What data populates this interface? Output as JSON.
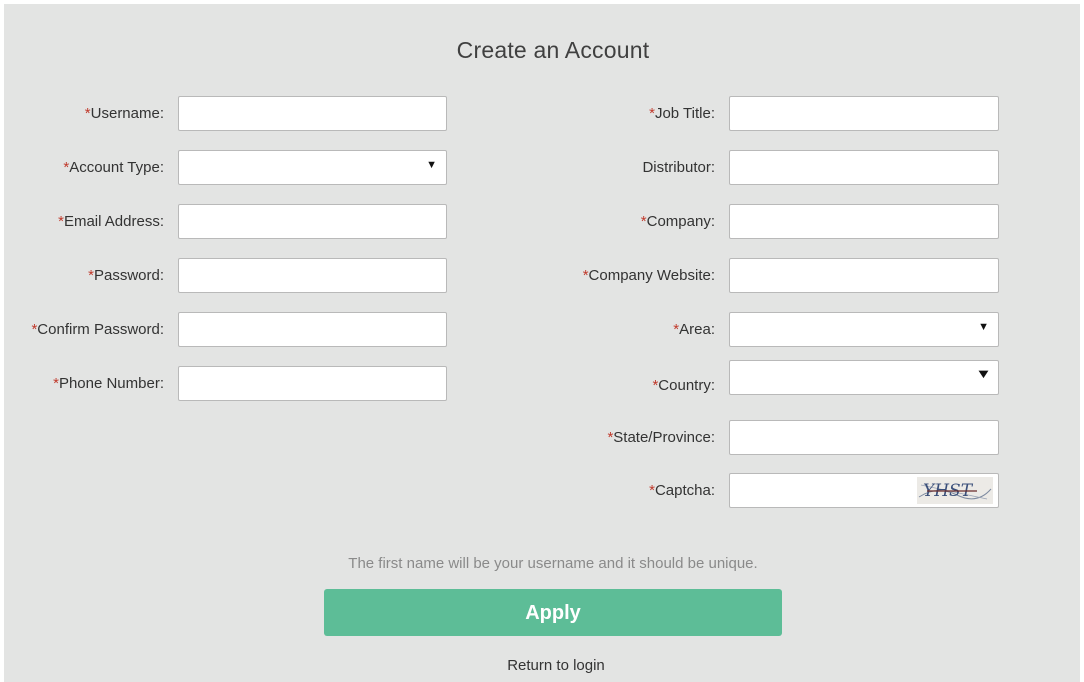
{
  "title": "Create an Account",
  "required_mark": "*",
  "left_fields": [
    {
      "label": "Username:",
      "required": true,
      "type": "text",
      "value": ""
    },
    {
      "label": "Account Type:",
      "required": true,
      "type": "select",
      "value": ""
    },
    {
      "label": "Email Address:",
      "required": true,
      "type": "text",
      "value": ""
    },
    {
      "label": "Password:",
      "required": true,
      "type": "text",
      "value": ""
    },
    {
      "label": "Confirm Password:",
      "required": true,
      "type": "text",
      "value": ""
    },
    {
      "label": "Phone Number:",
      "required": true,
      "type": "text",
      "value": ""
    }
  ],
  "right_fields": [
    {
      "label": "Job Title:",
      "required": true,
      "type": "text",
      "value": ""
    },
    {
      "label": "Distributor:",
      "required": false,
      "type": "text",
      "value": ""
    },
    {
      "label": "Company:",
      "required": true,
      "type": "text",
      "value": ""
    },
    {
      "label": "Company Website:",
      "required": true,
      "type": "text",
      "value": ""
    },
    {
      "label": "Area:",
      "required": true,
      "type": "select",
      "value": ""
    },
    {
      "label": "Country:",
      "required": true,
      "type": "select",
      "value": ""
    },
    {
      "label": "State/Province:",
      "required": true,
      "type": "text",
      "value": ""
    },
    {
      "label": "Captcha:",
      "required": true,
      "type": "captcha",
      "value": ""
    }
  ],
  "captcha_text": "YHST",
  "hint": "The first name will be your username and it should be unique.",
  "apply_label": "Apply",
  "return_label": "Return to login",
  "colors": {
    "accent": "#5dbd97",
    "required": "#c0392b",
    "panel": "#e3e4e3"
  }
}
